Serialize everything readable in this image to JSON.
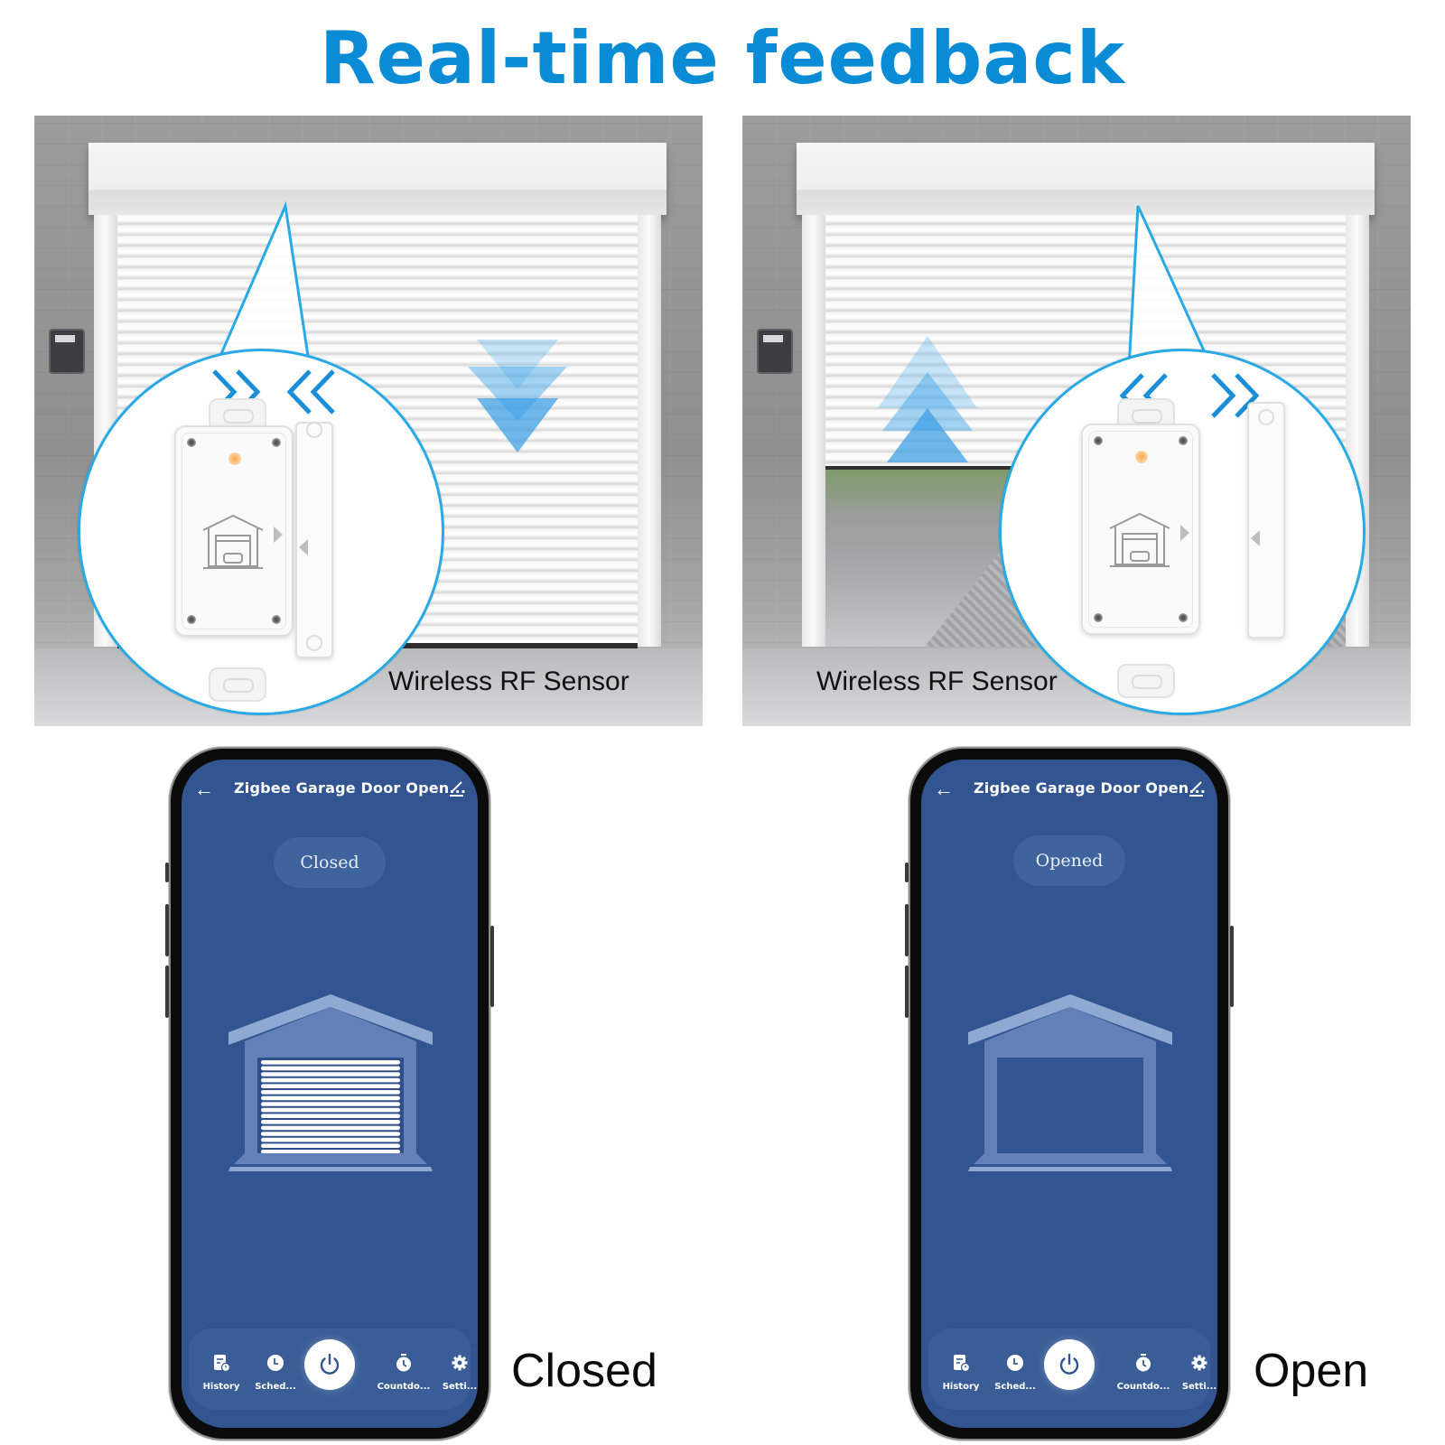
{
  "headline": "Real-time feedback",
  "scenes": [
    {
      "state": "closing",
      "door_motion": "down",
      "signal_direction": "toward-each-other",
      "caption": "Wireless RF Sensor"
    },
    {
      "state": "opening",
      "door_motion": "up",
      "signal_direction": "away-from-each-other",
      "caption": "Wireless RF Sensor"
    }
  ],
  "phones": [
    {
      "title": "Zigbee Garage Door Open...",
      "back_icon": "arrow-left-icon",
      "edit_icon": "pencil-icon",
      "status": "Closed",
      "illustration": "garage-closed",
      "nav": [
        {
          "label": "History",
          "icon": "history-icon"
        },
        {
          "label": "Sched...",
          "icon": "clock-icon"
        },
        {
          "label": "Countdo...",
          "icon": "stopwatch-icon"
        },
        {
          "label": "Setti...",
          "icon": "gear-icon"
        }
      ],
      "power_icon": "power-icon",
      "caption": "Closed"
    },
    {
      "title": "Zigbee Garage Door Open...",
      "back_icon": "arrow-left-icon",
      "edit_icon": "pencil-icon",
      "status": "Opened",
      "illustration": "garage-open",
      "nav": [
        {
          "label": "History",
          "icon": "history-icon"
        },
        {
          "label": "Sched...",
          "icon": "clock-icon"
        },
        {
          "label": "Countdo...",
          "icon": "stopwatch-icon"
        },
        {
          "label": "Setti...",
          "icon": "gear-icon"
        }
      ],
      "power_icon": "power-icon",
      "caption": "Open"
    }
  ],
  "colors": {
    "accent": "#0a8bd6",
    "callout": "#29a9e6",
    "screen_bg": "#325591",
    "pill_bg": "#3f639d"
  }
}
